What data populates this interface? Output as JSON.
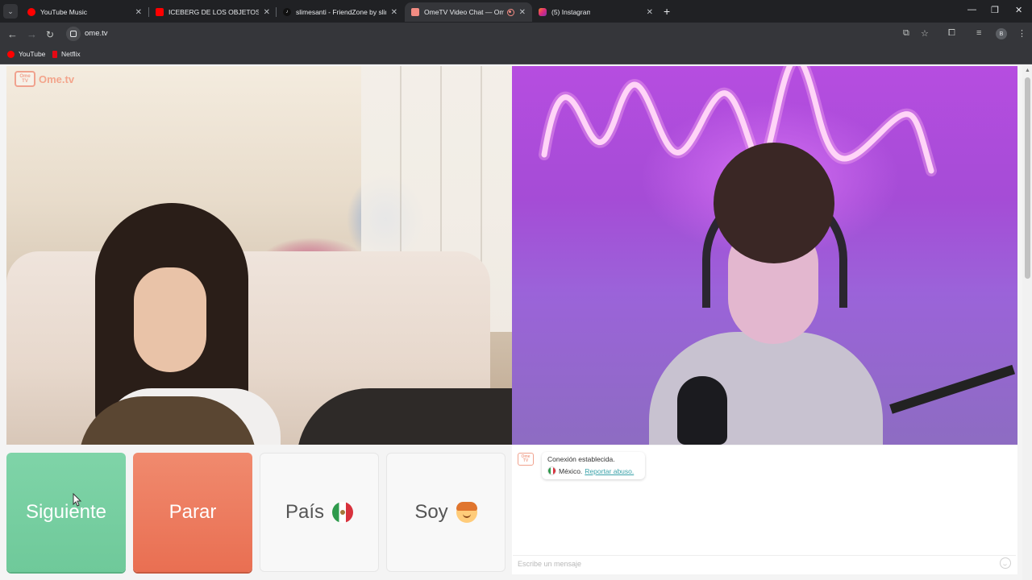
{
  "browser": {
    "tabs": [
      {
        "title": "YouTube Music",
        "favicon": "youtube-music-icon",
        "color": "#ff0000",
        "active": false
      },
      {
        "title": "ICEBERG DE LOS OBJETOS PERI",
        "favicon": "youtube-icon",
        "color": "#ff0000",
        "active": false
      },
      {
        "title": "slimesanti - FriendZone by slim",
        "favicon": "tiktok-icon",
        "color": "#000000",
        "active": false
      },
      {
        "title": "OmeTV Video Chat — Ome",
        "favicon": "ometv-icon",
        "color": "#f28b82",
        "active": true
      },
      {
        "title": "(5) Instagram",
        "favicon": "instagram-icon",
        "color": "#e1306c",
        "active": false
      }
    ],
    "url": "ome.tv",
    "profile_initial": "B",
    "bookmarks": [
      {
        "label": "YouTube",
        "favicon": "youtube-icon",
        "color": "#ff0000"
      },
      {
        "label": "Netflix",
        "favicon": "netflix-icon",
        "color": "#e50914"
      }
    ]
  },
  "site": {
    "logo_text": "Ome.tv",
    "logo_badge": "Ome TV",
    "brand_color": "#f0a28e"
  },
  "controls": {
    "next_label": "Siguiente",
    "stop_label": "Parar",
    "country_label": "País",
    "country_flag": "mexico-flag-icon",
    "gender_label": "Soy",
    "gender_icon": "boy-emoji-icon",
    "next_color": "#7fd4a8",
    "stop_color": "#f08a6e"
  },
  "chat": {
    "status": "Conexión establecida.",
    "country": "México.",
    "report_link": "Reportar abuso.",
    "input_placeholder": "Escribe un mensaje"
  }
}
